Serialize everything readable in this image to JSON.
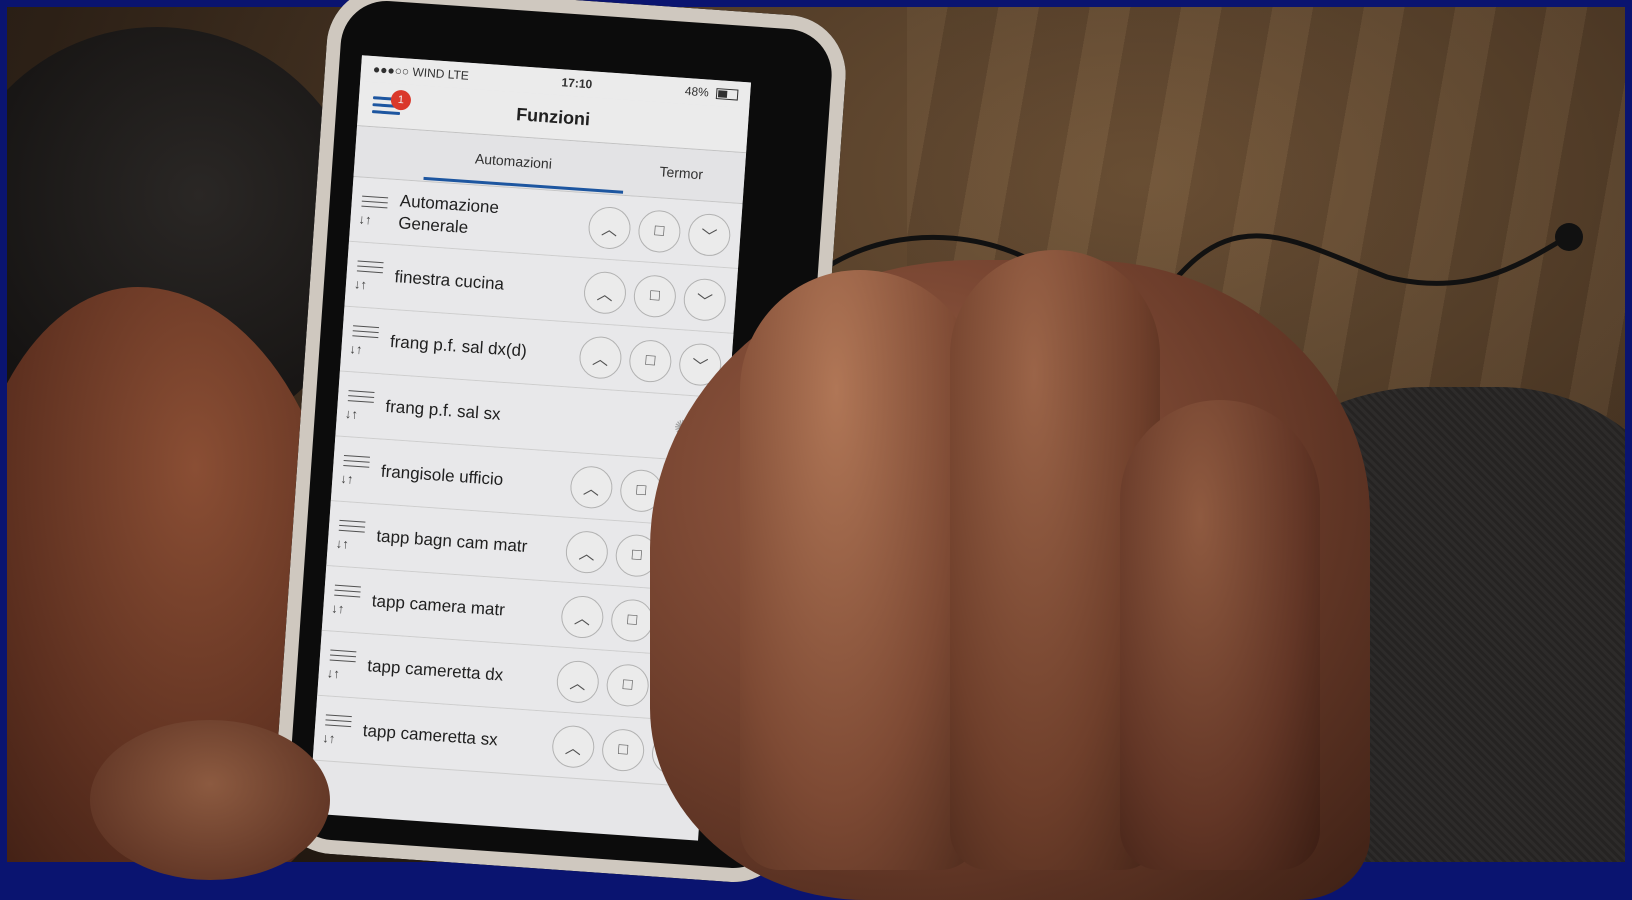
{
  "status_bar": {
    "carrier": "●●●○○ WIND  LTE",
    "time": "17:10",
    "battery": "48%"
  },
  "nav": {
    "title": "Funzioni",
    "badge": "1"
  },
  "tabs": [
    {
      "label": "Automazioni"
    },
    {
      "label": "Termor"
    }
  ],
  "rows": [
    {
      "name": "Automazione Generale"
    },
    {
      "name": "finestra cucina"
    },
    {
      "name": "frang p.f. sal dx(d)"
    },
    {
      "name": "frang p.f. sal sx"
    },
    {
      "name": "frangisole ufficio"
    },
    {
      "name": "tapp bagn cam matr"
    },
    {
      "name": "tapp camera matr"
    },
    {
      "name": "tapp cameretta dx"
    },
    {
      "name": "tapp cameretta sx"
    }
  ],
  "icons": {
    "up": "chevron-up-icon",
    "stop": "stop-square-icon",
    "down": "chevron-down-icon",
    "reorder": "reorder-icon",
    "loading": "loading-spinner-icon",
    "menu": "menu-icon"
  },
  "colors": {
    "accent": "#1f5aa8",
    "badge": "#e53b2c"
  }
}
